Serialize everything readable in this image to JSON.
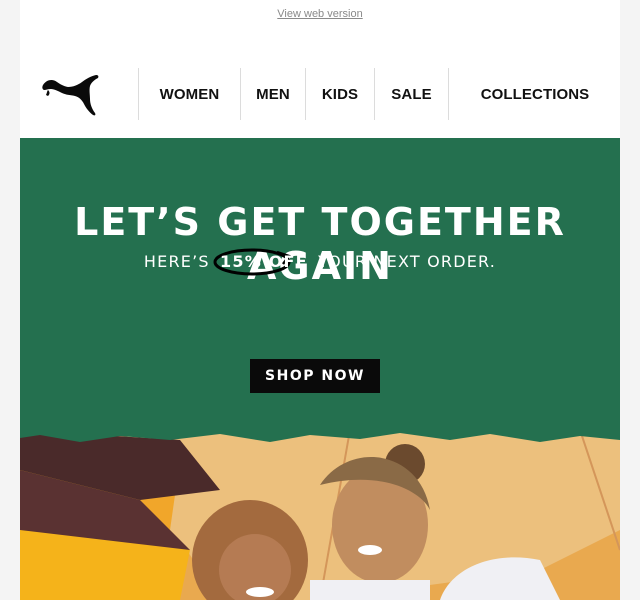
{
  "preheader": {
    "view_web_label": "View web version"
  },
  "nav": {
    "items": [
      {
        "label": "WOMEN"
      },
      {
        "label": "MEN"
      },
      {
        "label": "KIDS"
      },
      {
        "label": "SALE"
      },
      {
        "label": "COLLECTIONS"
      }
    ]
  },
  "hero": {
    "headline": "LET’S GET TOGETHER AGAIN",
    "sub_before": "HERE’S",
    "sub_highlight": "15% OFF",
    "sub_after": "YOUR NEXT ORDER.",
    "cta_label": "SHOP NOW",
    "background_color": "#24704f"
  },
  "icons": {
    "logo": "puma-logo-icon"
  }
}
